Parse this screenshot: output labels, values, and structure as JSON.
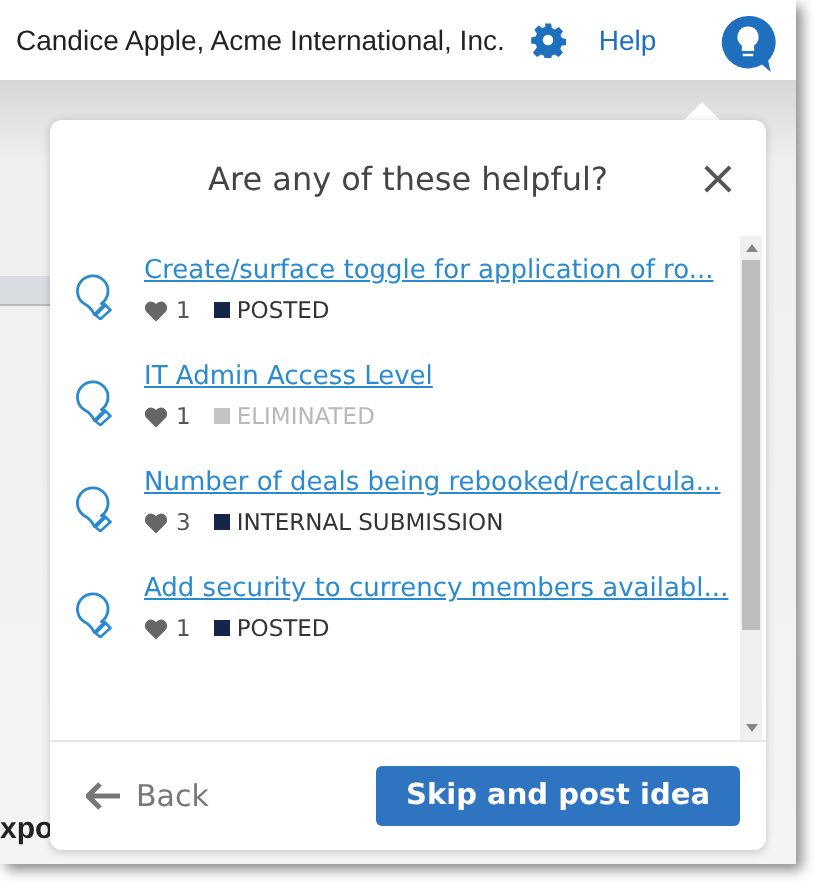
{
  "header": {
    "user": "Candice Apple, Acme International, Inc.",
    "help": "Help"
  },
  "background_text": "xpo",
  "dialog": {
    "title": "Are any of these helpful?",
    "close": "×",
    "ideas": [
      {
        "title": "Create/surface toggle for application of ro...",
        "votes": "1",
        "status": "POSTED",
        "color": "#15264a",
        "muted": false
      },
      {
        "title": "IT Admin Access Level",
        "votes": "1",
        "status": "ELIMINATED",
        "color": "#c4c4c4",
        "muted": true
      },
      {
        "title": "Number of deals being rebooked/recalcula...",
        "votes": "3",
        "status": "INTERNAL SUBMISSION",
        "color": "#15264a",
        "muted": false
      },
      {
        "title": "Add security to currency members availabl...",
        "votes": "1",
        "status": "POSTED",
        "color": "#15264a",
        "muted": false
      }
    ],
    "back": "Back",
    "primary": "Skip and post idea"
  }
}
